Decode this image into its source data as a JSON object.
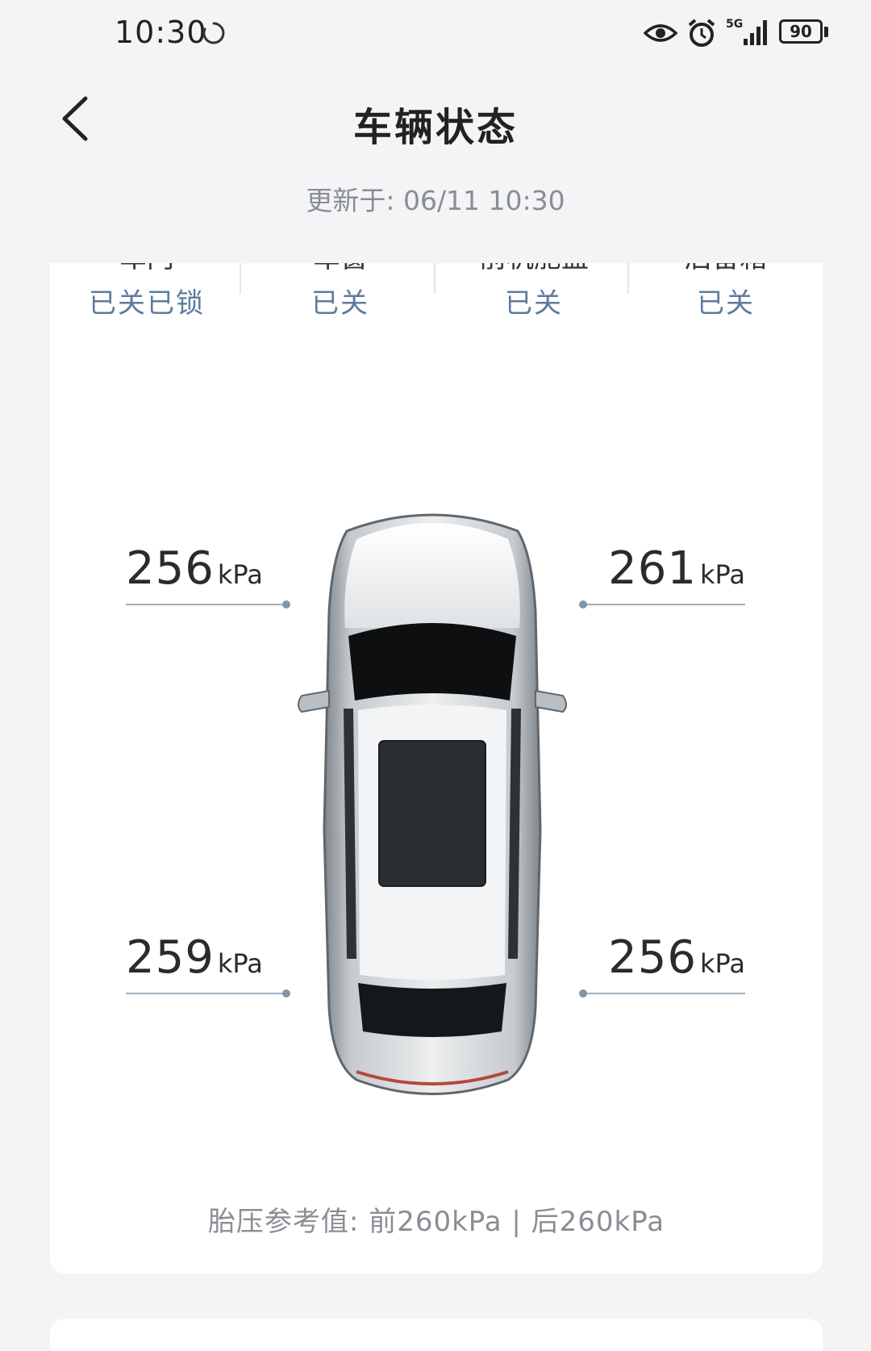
{
  "status_bar": {
    "time": "10:30",
    "network": "5G",
    "battery": "90",
    "icons": [
      "sync-icon",
      "eye-icon",
      "alarm-icon",
      "signal-icon",
      "battery-icon"
    ]
  },
  "header": {
    "title": "车辆状态",
    "updated": "更新于: 06/11 10:30",
    "back_icon": "chevron-left-icon"
  },
  "status_row": [
    {
      "value": "已关已锁"
    },
    {
      "value": "已关"
    },
    {
      "value": "已关"
    },
    {
      "value": "已关"
    }
  ],
  "tires": {
    "front_left": {
      "value": "256",
      "unit": "kPa"
    },
    "front_right": {
      "value": "261",
      "unit": "kPa"
    },
    "rear_left": {
      "value": "259",
      "unit": "kPa"
    },
    "rear_right": {
      "value": "256",
      "unit": "kPa"
    }
  },
  "reference": "胎压参考值:  前260kPa | 后260kPa",
  "colors": {
    "accent": "#5c7ba0",
    "muted": "#8a8d93",
    "background": "#f3f4f6",
    "card": "#ffffff"
  }
}
